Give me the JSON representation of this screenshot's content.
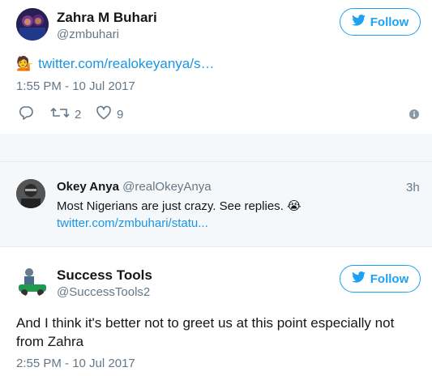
{
  "tweet1": {
    "name": "Zahra M Buhari",
    "handle": "@zmbuhari",
    "follow_label": "Follow",
    "link_text": "twitter.com/realokeyanya/s…",
    "timestamp": "1:55 PM - 10 Jul 2017",
    "retweets": "2",
    "likes": "9"
  },
  "quoted": {
    "name": "Okey Anya",
    "handle": "@realOkeyAnya",
    "age": "3h",
    "text": "Most Nigerians are just crazy. See replies.",
    "emoji": "😭",
    "link_text": "twitter.com/zmbuhari/statu..."
  },
  "tweet2": {
    "name": "Success Tools",
    "handle": "@SuccessTools2",
    "follow_label": "Follow",
    "text": "And I think it's better not to greet us at this point especially not from Zahra",
    "timestamp": "2:55 PM - 10 Jul 2017"
  },
  "colors": {
    "twitter_blue": "#1da1f2",
    "link_blue": "#1b95e0",
    "secondary_text": "#657786",
    "background_gray": "#f5f8fa"
  },
  "icons": {
    "follow_bird": "twitter-bird-icon",
    "reply": "reply-icon",
    "retweet": "retweet-icon",
    "like": "heart-icon",
    "info": "info-icon",
    "person_emoji": "person-tipping-hand-emoji"
  }
}
